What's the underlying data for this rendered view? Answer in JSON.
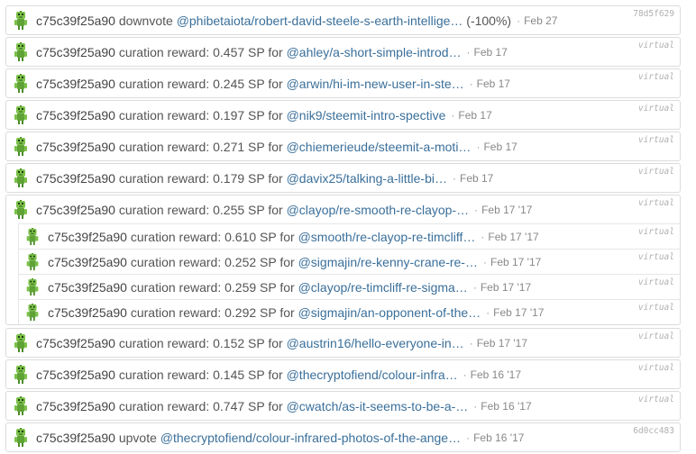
{
  "ops": [
    {
      "user": "c75c39f25a90",
      "action": "downvote",
      "link": "@phibetaiota/robert-david-steele-s-earth-intellige…",
      "extra": "(-100%)",
      "date": "Feb 27",
      "tag": "78d5f629"
    },
    {
      "user": "c75c39f25a90",
      "action": "curation reward: 0.457 SP for",
      "link": "@ahley/a-short-simple-introd…",
      "extra": "",
      "date": "Feb 17",
      "tag": "virtual"
    },
    {
      "user": "c75c39f25a90",
      "action": "curation reward: 0.245 SP for",
      "link": "@arwin/hi-im-new-user-in-ste…",
      "extra": "",
      "date": "Feb 17",
      "tag": "virtual"
    },
    {
      "user": "c75c39f25a90",
      "action": "curation reward: 0.197 SP for",
      "link": "@nik9/steemit-intro-spective",
      "extra": "",
      "date": "Feb 17",
      "tag": "virtual"
    },
    {
      "user": "c75c39f25a90",
      "action": "curation reward: 0.271 SP for",
      "link": "@chiemerieude/steemit-a-moti…",
      "extra": "",
      "date": "Feb 17",
      "tag": "virtual"
    },
    {
      "user": "c75c39f25a90",
      "action": "curation reward: 0.179 SP for",
      "link": "@davix25/talking-a-little-bi…",
      "extra": "",
      "date": "Feb 17",
      "tag": "virtual"
    },
    {
      "user": "c75c39f25a90",
      "action": "curation reward: 0.255 SP for",
      "link": "@clayop/re-smooth-re-clayop-…",
      "extra": "",
      "date": "Feb 17 '17",
      "tag": "virtual",
      "children": [
        {
          "user": "c75c39f25a90",
          "action": "curation reward: 0.610 SP for",
          "link": "@smooth/re-clayop-re-timcliff…",
          "date": "Feb 17 '17",
          "tag": "virtual"
        },
        {
          "user": "c75c39f25a90",
          "action": "curation reward: 0.252 SP for",
          "link": "@sigmajin/re-kenny-crane-re-…",
          "date": "Feb 17 '17",
          "tag": "virtual"
        },
        {
          "user": "c75c39f25a90",
          "action": "curation reward: 0.259 SP for",
          "link": "@clayop/re-timcliff-re-sigma…",
          "date": "Feb 17 '17",
          "tag": "virtual"
        },
        {
          "user": "c75c39f25a90",
          "action": "curation reward: 0.292 SP for",
          "link": "@sigmajin/an-opponent-of-the…",
          "date": "Feb 17 '17",
          "tag": "virtual"
        }
      ]
    },
    {
      "user": "c75c39f25a90",
      "action": "curation reward: 0.152 SP for",
      "link": "@austrin16/hello-everyone-in…",
      "extra": "",
      "date": "Feb 17 '17",
      "tag": "virtual"
    },
    {
      "user": "c75c39f25a90",
      "action": "curation reward: 0.145 SP for",
      "link": "@thecryptofiend/colour-infra…",
      "extra": "",
      "date": "Feb 16 '17",
      "tag": "virtual"
    },
    {
      "user": "c75c39f25a90",
      "action": "curation reward: 0.747 SP for",
      "link": "@cwatch/as-it-seems-to-be-a-…",
      "extra": "",
      "date": "Feb 16 '17",
      "tag": "virtual"
    },
    {
      "user": "c75c39f25a90",
      "action": "upvote",
      "link": "@thecryptofiend/colour-infrared-photos-of-the-ange…",
      "extra": "",
      "date": "Feb 16 '17",
      "tag": "6d0cc483"
    }
  ],
  "separator": "·"
}
